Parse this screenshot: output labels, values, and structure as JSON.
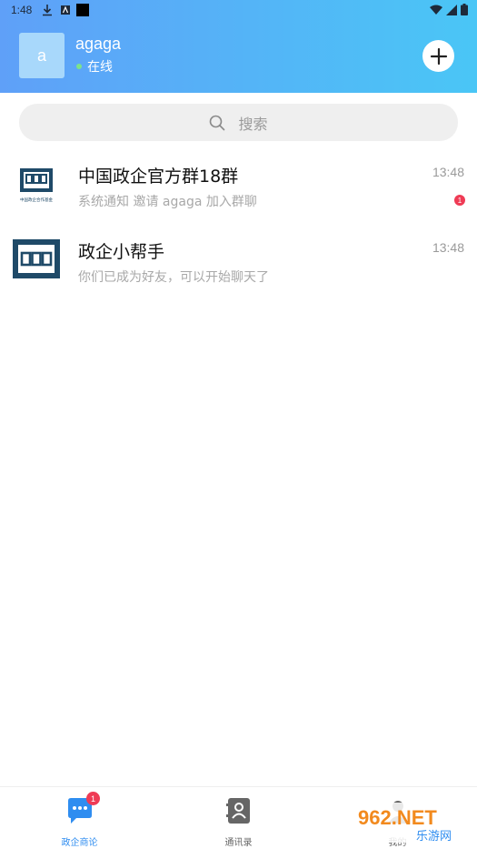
{
  "status_bar": {
    "time": "1:48"
  },
  "header": {
    "avatar_letter": "a",
    "username": "agaga",
    "status": "在线"
  },
  "search": {
    "placeholder": "搜索"
  },
  "conversations": [
    {
      "title": "中国政企官方群18群",
      "preview": "系统通知 邀请 agaga 加入群聊",
      "time": "13:48",
      "unread": "1",
      "avatar_caption": "中国政企合作基金"
    },
    {
      "title": "政企小帮手",
      "preview": "你们已成为好友，可以开始聊天了",
      "time": "13:48"
    }
  ],
  "bottom_nav": {
    "items": [
      {
        "label": "政企商论",
        "badge": "1"
      },
      {
        "label": "通讯录"
      },
      {
        "label": "我的"
      }
    ]
  },
  "watermark": {
    "brand": "962.NET",
    "sub": "乐游网"
  },
  "colors": {
    "header_gradient_start": "#5fa0f8",
    "header_gradient_end": "#4ac6f6",
    "accent": "#2f8df0",
    "badge": "#ef3b55",
    "online": "#7de38a"
  },
  "icons": {
    "add": "plus-circle-icon",
    "search": "search-icon",
    "chats_tab": "chat-bubble-icon",
    "contacts_tab": "contact-book-icon"
  }
}
